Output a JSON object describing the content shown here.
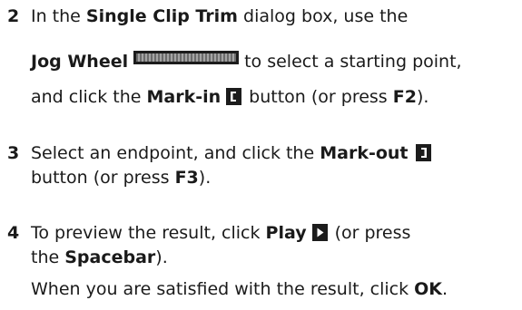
{
  "steps": [
    {
      "number": "2",
      "lines": {
        "l1": {
          "a": "In the ",
          "b": "Single Clip Trim",
          "c": " dialog box, use the"
        },
        "l2": {
          "a": "Jog Wheel",
          "b": "to select a starting point,"
        },
        "l3": {
          "a": "and click the ",
          "b": "Mark-in",
          "c": "button (or press ",
          "d": "F2",
          "e": ")."
        }
      }
    },
    {
      "number": "3",
      "lines": {
        "l1": {
          "a": "Select an endpoint, and click the ",
          "b": "Mark-out"
        },
        "l2": {
          "a": "button (or press ",
          "b": "F3",
          "c": ")."
        }
      }
    },
    {
      "number": "4",
      "lines": {
        "l1": {
          "a": "To preview the result, click ",
          "b": "Play",
          "c": "(or press"
        },
        "l2": {
          "a": "the ",
          "b": "Spacebar",
          "c": ")."
        },
        "l3": {
          "a": "When you are satisfied with the result, click ",
          "b": "OK",
          "c": "."
        }
      }
    }
  ],
  "icons": {
    "jog_wheel": "jog-wheel-icon",
    "mark_in": "mark-in-icon",
    "mark_out": "mark-out-icon",
    "play": "play-icon"
  },
  "colors": {
    "text": "#1a1a1a",
    "icon_dark": "#1c1c1c"
  }
}
